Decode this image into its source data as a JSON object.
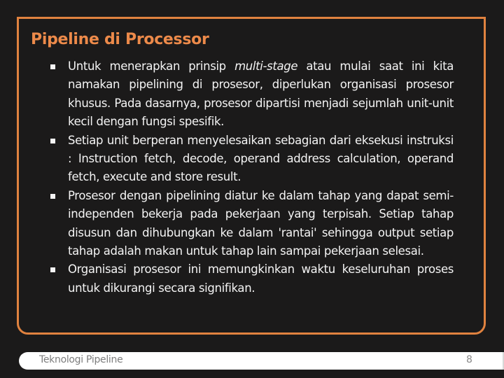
{
  "slide": {
    "title": "Pipeline di Processor",
    "accent_color": "#e0823f",
    "title_color": "#ed8a4a",
    "background_color": "#1b1a1a",
    "bullet_icon": "square-bullet",
    "bullets": [
      {
        "before_italic": "Untuk menerapkan prinsip ",
        "italic": "multi-stage",
        "after_italic": " atau mulai saat ini kita namakan pipelining di prosesor, diperlukan organisasi prosesor khusus. Pada dasarnya, prosesor dipartisi menjadi sejumlah unit-unit kecil dengan fungsi spesifik."
      },
      {
        "text": "Setiap unit berperan menyelesaikan sebagian dari eksekusi instruksi : Instruction fetch, decode, operand address calculation, operand fetch, execute and store result."
      },
      {
        "text": "Prosesor dengan pipelining diatur ke dalam tahap yang dapat semi-independen bekerja pada pekerjaan yang terpisah. Setiap tahap disusun dan dihubungkan ke dalam 'rantai' sehingga output setiap tahap adalah makan untuk tahap lain sampai pekerjaan selesai."
      },
      {
        "text": "Organisasi prosesor ini memungkinkan waktu keseluruhan proses untuk dikurangi secara signifikan."
      }
    ]
  },
  "footer": {
    "title": "Teknologi Pipeline",
    "page_number": "8"
  }
}
